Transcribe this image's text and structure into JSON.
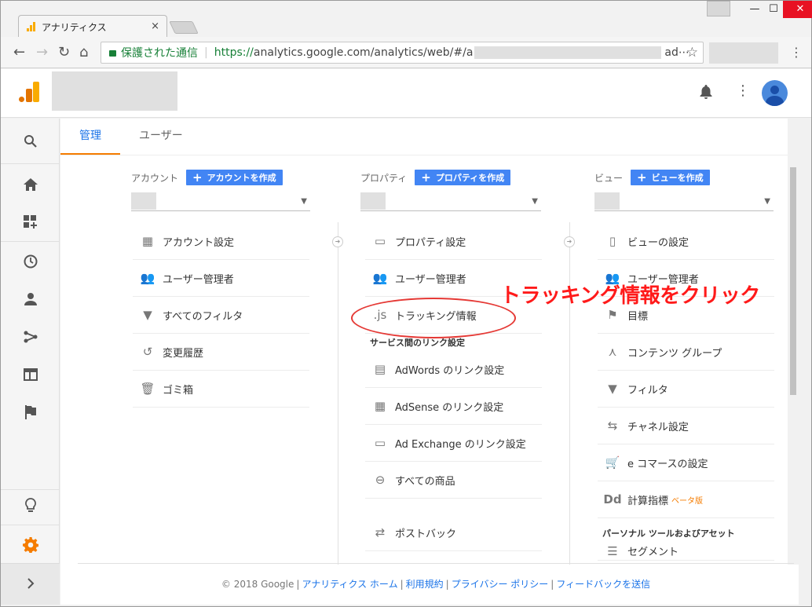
{
  "browser": {
    "tab_title": "アナリティクス",
    "tab_close": "×",
    "secure_label": "保護された通信",
    "url_prefix": "https://",
    "url_host": "analytics.google.com",
    "url_path": "/analytics/web/#/a",
    "url_suffix": "ad⋯",
    "star": "☆"
  },
  "window_controls": [
    "—",
    "☐",
    "✕"
  ],
  "nav_buttons": {
    "back": "←",
    "forward": "→",
    "reload": "↻",
    "home": "⌂"
  },
  "header": {
    "bell": "🔔",
    "more": "⋮"
  },
  "sidebar_icons": [
    "search-icon",
    "home-icon",
    "dashboard-icon",
    "clock-icon",
    "person-icon",
    "branch-icon",
    "window-icon",
    "flag-icon",
    "lightbulb-icon",
    "gear-icon",
    "chevron-right-icon"
  ],
  "tabs": [
    "管理",
    "ユーザー"
  ],
  "account": {
    "label": "アカウント",
    "create": "アカウントを作成",
    "items": [
      "アカウント設定",
      "ユーザー管理者",
      "すべてのフィルタ",
      "変更履歴",
      "ゴミ箱"
    ]
  },
  "property": {
    "label": "プロパティ",
    "create": "プロパティを作成",
    "items": [
      "プロパティ設定",
      "ユーザー管理者",
      "トラッキング情報"
    ],
    "js_icon_text": ".js",
    "section": "サービス間のリンク設定",
    "link_items": [
      "AdWords のリンク設定",
      "AdSense のリンク設定",
      "Ad Exchange のリンク設定",
      "すべての商品"
    ],
    "postback": "ポストバック"
  },
  "view": {
    "label": "ビュー",
    "create": "ビューを作成",
    "items": [
      "ビューの設定",
      "ユーザー管理者",
      "目標",
      "コンテンツ グループ",
      "フィルタ",
      "チャネル設定",
      "e コマースの設定",
      "計算指標"
    ],
    "beta": "ベータ版",
    "dd_icon_text": "Dd",
    "section": "パーソナル ツールおよびアセット",
    "segment": "セグメント"
  },
  "footer": {
    "copyright": "© 2018 Google",
    "links": [
      "アナリティクス ホーム",
      "利用規約",
      "プライバシー ポリシー",
      "フィードバックを送信"
    ],
    "sep": "|"
  },
  "annotation": "トラッキング情報をクリック",
  "colors": {
    "accent": "#1a73e8",
    "button": "#4285f4",
    "annotation": "#ff1a1a",
    "tab_underline": "#f57c00"
  }
}
